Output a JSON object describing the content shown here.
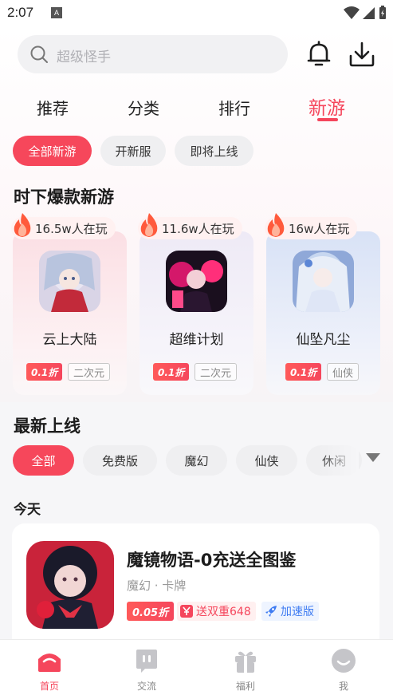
{
  "status_bar": {
    "time": "2:07",
    "badge": "A"
  },
  "search": {
    "placeholder": "超级怪手"
  },
  "tabs": [
    {
      "label": "推荐"
    },
    {
      "label": "分类"
    },
    {
      "label": "排行"
    },
    {
      "label": "新游",
      "active": true
    }
  ],
  "filter_chips": [
    {
      "label": "全部新游",
      "active": true
    },
    {
      "label": "开新服"
    },
    {
      "label": "即将上线"
    }
  ],
  "hot_section": {
    "title": "时下爆款新游",
    "cards": [
      {
        "players": "16.5w人在玩",
        "name": "云上大陆",
        "discount": "0.1折",
        "tag": "二次元"
      },
      {
        "players": "11.6w人在玩",
        "name": "超维计划",
        "discount": "0.1折",
        "tag": "二次元"
      },
      {
        "players": "16w人在玩",
        "name": "仙坠凡尘",
        "discount": "0.1折",
        "tag": "仙侠"
      }
    ]
  },
  "new_section": {
    "title": "最新上线",
    "chips": [
      {
        "label": "全部",
        "active": true
      },
      {
        "label": "免费版"
      },
      {
        "label": "魔幻"
      },
      {
        "label": "仙侠"
      },
      {
        "label": "休闲"
      }
    ]
  },
  "today": {
    "label": "今天",
    "game": {
      "title": "魔镜物语-0充送全图鉴",
      "meta": "魔幻 · 卡牌",
      "discount": "0.05折",
      "gift": "送双重648",
      "speed": "加速版"
    }
  },
  "bottom_nav": [
    {
      "label": "首页",
      "active": true,
      "icon": "home-icon"
    },
    {
      "label": "交流",
      "icon": "chat-icon"
    },
    {
      "label": "福利",
      "icon": "gift-icon"
    },
    {
      "label": "我",
      "icon": "profile-icon"
    }
  ],
  "colors": {
    "accent": "#f5465c",
    "speed": "#3f7cf2"
  }
}
